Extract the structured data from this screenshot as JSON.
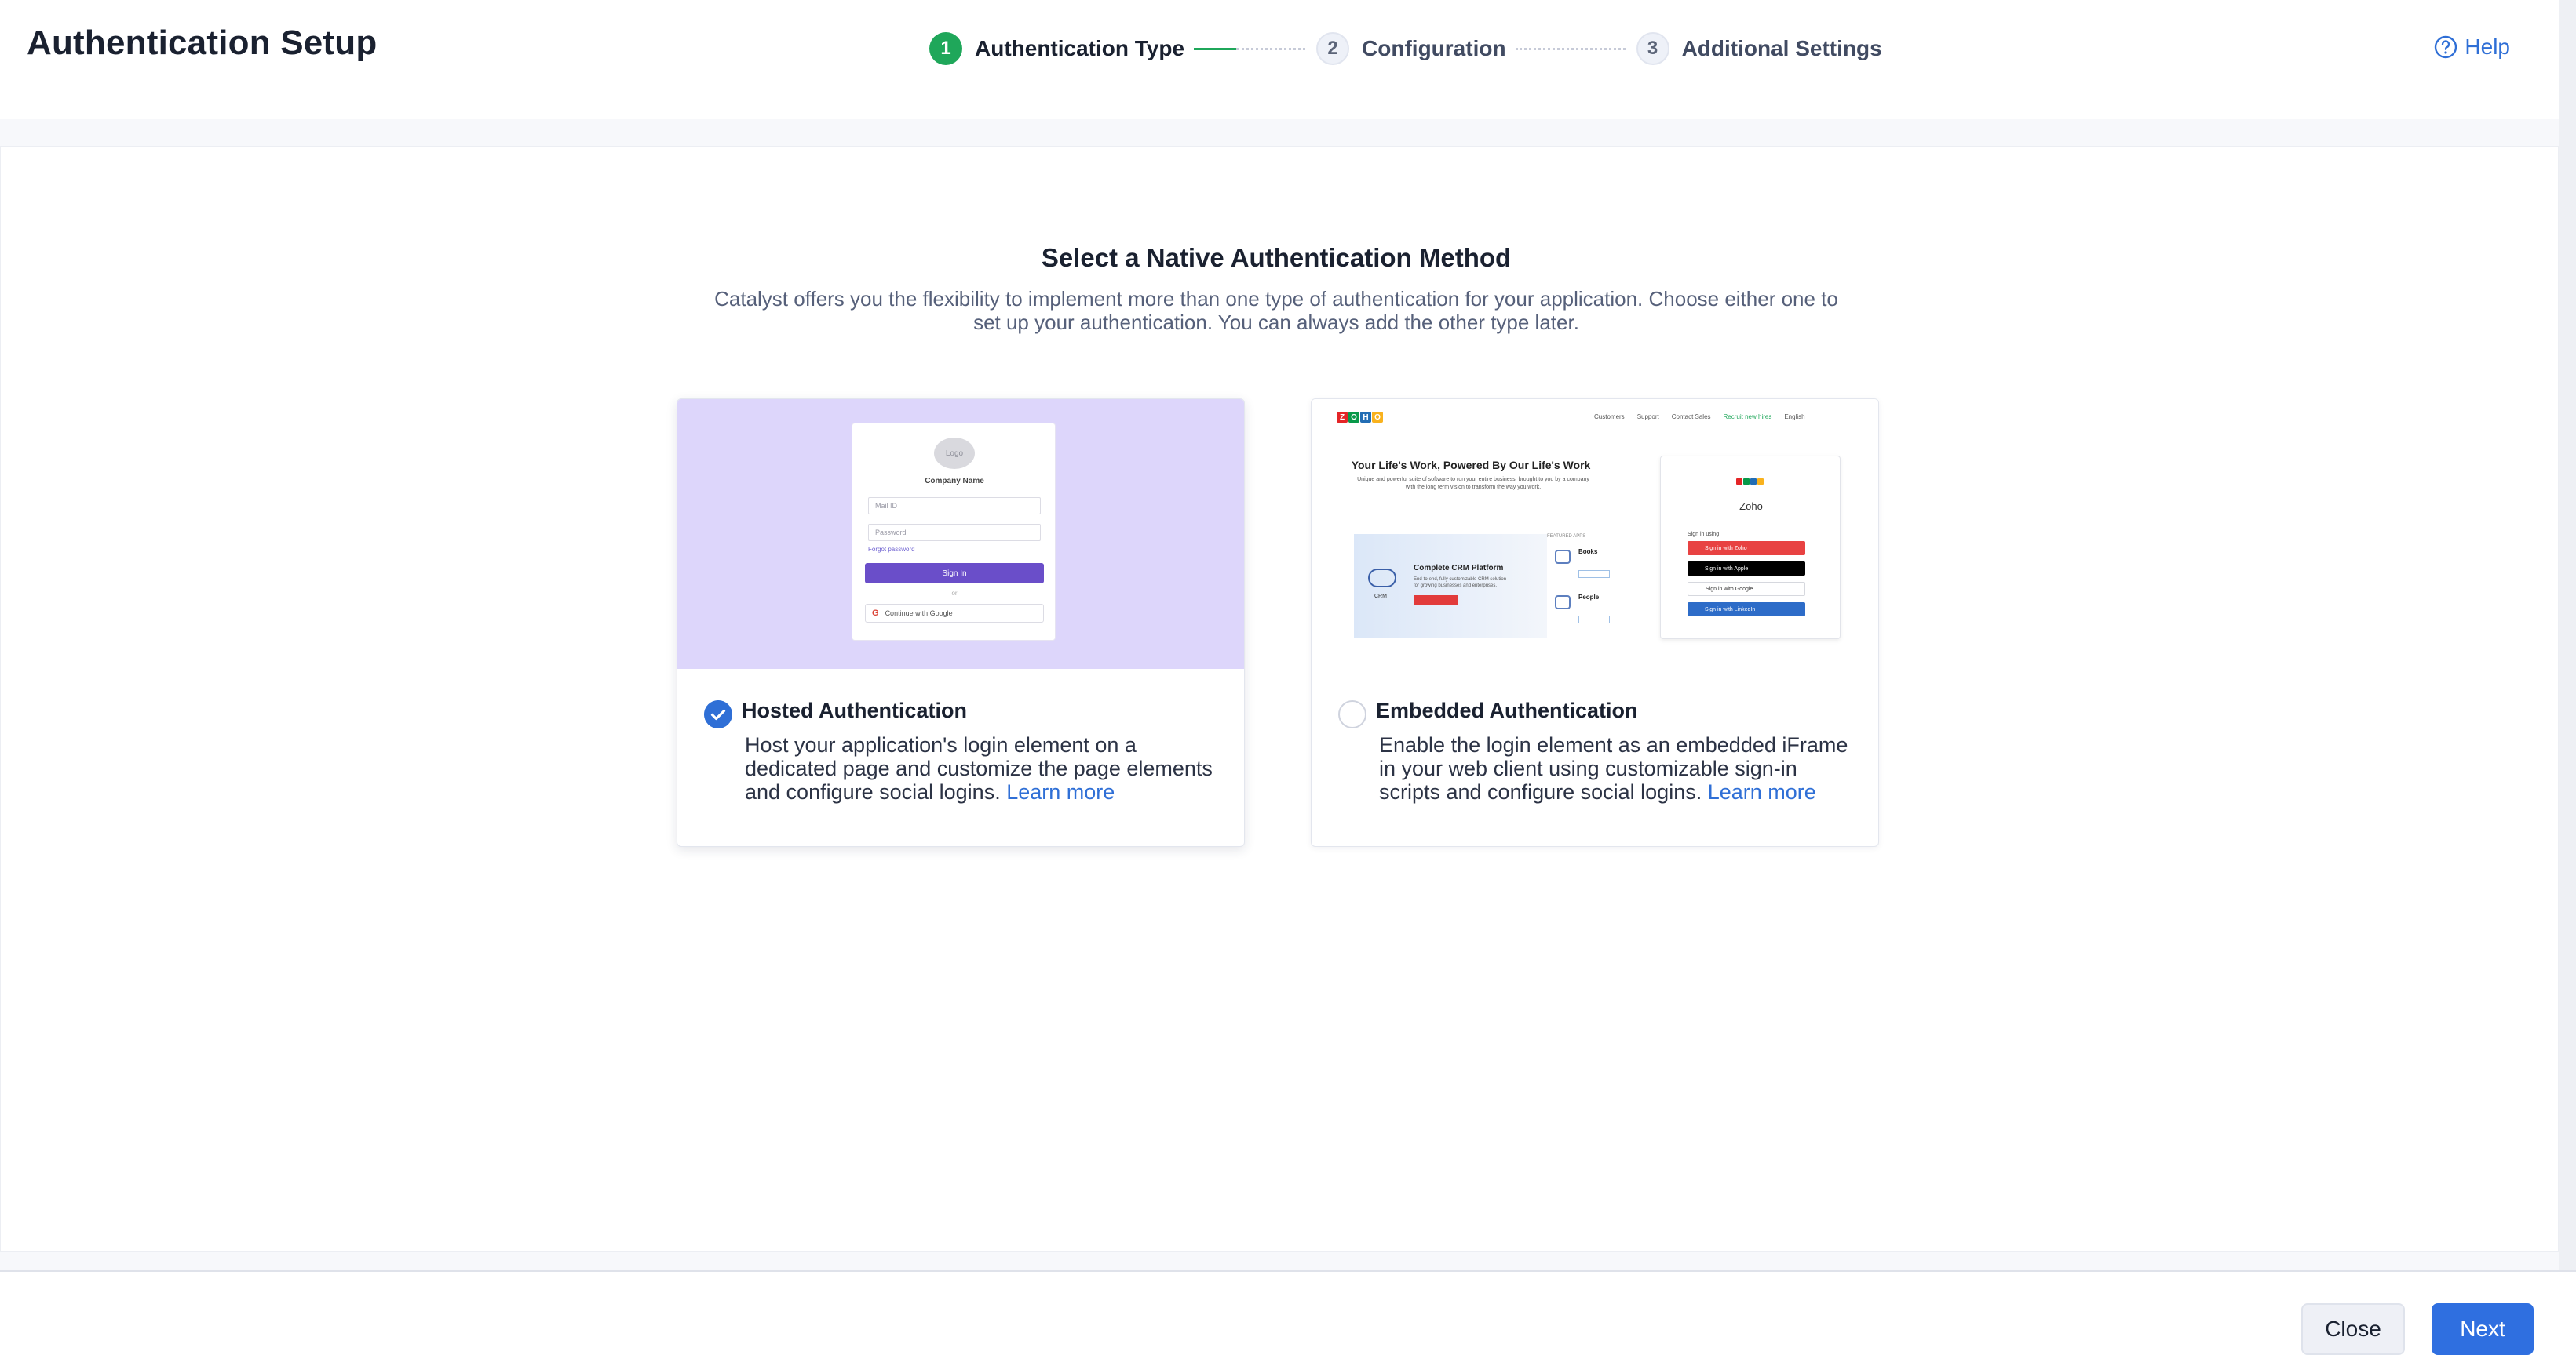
{
  "header": {
    "title": "Authentication Setup",
    "help_label": "Help"
  },
  "stepper": {
    "steps": [
      {
        "number": "1",
        "label": "Authentication Type",
        "state": "active"
      },
      {
        "number": "2",
        "label": "Configuration",
        "state": "pending"
      },
      {
        "number": "3",
        "label": "Additional Settings",
        "state": "pending"
      }
    ]
  },
  "main": {
    "title": "Select a Native Authentication Method",
    "description": "Catalyst offers you the flexibility to implement more than one type of authentication for your application. Choose either one to set up your authentication. You can always add the other type later."
  },
  "cards": {
    "hosted": {
      "title": "Hosted Authentication",
      "description": "Host your application's login element on a dedicated page and customize the page elements and configure social logins.",
      "learn_more": "Learn more",
      "selected": true,
      "preview": {
        "logo": "Logo",
        "company": "Company Name",
        "mail_placeholder": "Mail ID",
        "password_placeholder": "Password",
        "forgot": "Forgot password",
        "signin": "Sign In",
        "or": "or",
        "google": "Continue with Google"
      }
    },
    "embedded": {
      "title": "Embedded Authentication",
      "description": "Enable the login element as an embedded iFrame in your web client using customizable sign-in scripts and configure social logins.",
      "learn_more": "Learn more",
      "selected": false,
      "preview": {
        "nav": [
          "Customers",
          "Support",
          "Contact Sales",
          "Recruit new hires",
          "English"
        ],
        "headline": "Your Life's Work, Powered By Our Life's Work",
        "sub": "Unique and powerful suite of software to run your entire business, brought to you by a company with the long term vision to transform the way you work.",
        "crm_title": "Complete CRM Platform",
        "crm_sub": "End-to-end, fully customizable CRM solution for growing businesses and enterprises.",
        "crm_label": "CRM",
        "featured": "FEATURED APPS",
        "app1": "Books",
        "app2": "People",
        "zoho": "Zoho",
        "sign_in_using": "Sign in using",
        "sso_buttons": [
          {
            "label": "Sign in with Zoho",
            "color": "#e84242",
            "text": "#ffffff"
          },
          {
            "label": "Sign in with Apple",
            "color": "#000000",
            "text": "#ffffff"
          },
          {
            "label": "Sign in with Google",
            "color": "#ffffff",
            "text": "#333333"
          },
          {
            "label": "Sign in with LinkedIn",
            "color": "#2d6cc8",
            "text": "#ffffff"
          }
        ]
      }
    }
  },
  "footer": {
    "close_label": "Close",
    "next_label": "Next"
  },
  "colors": {
    "accent": "#2f6fe0",
    "active_step": "#1fa75a",
    "hosted_preview_bg": "#ddd6fb"
  }
}
